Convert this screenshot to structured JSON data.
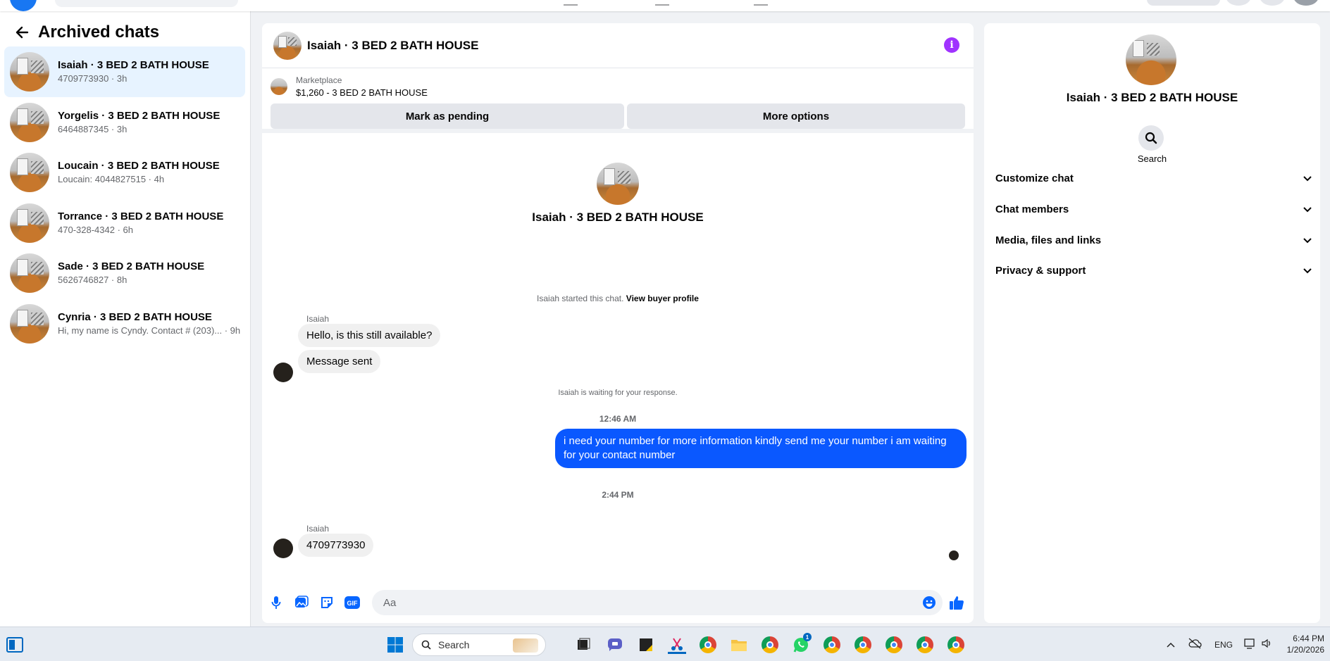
{
  "colors": {
    "accent": "#0a58ff",
    "info": "#a033ff",
    "active_row": "#e7f3ff",
    "panel_bg": "#f0f2f5"
  },
  "left_panel": {
    "title": "Archived chats",
    "chats": [
      {
        "name": "Isaiah · 3 BED 2 BATH HOUSE",
        "preview": "4709773930 · 3h",
        "active": true
      },
      {
        "name": "Yorgelis · 3 BED 2 BATH HOUSE",
        "preview": "6464887345 · 3h",
        "active": false
      },
      {
        "name": "Loucain · 3 BED 2 BATH HOUSE",
        "preview": "Loucain: 4044827515 · 4h",
        "active": false
      },
      {
        "name": "Torrance · 3 BED 2 BATH HOUSE",
        "preview": "470-328-4342 · 6h",
        "active": false
      },
      {
        "name": "Sade · 3 BED 2 BATH HOUSE",
        "preview": "5626746827 · 8h",
        "active": false
      },
      {
        "name": "Cynria · 3 BED 2 BATH HOUSE",
        "preview": "Hi, my name is Cyndy. Contact # (203)... · 9h",
        "active": false
      }
    ]
  },
  "conversation": {
    "title": "Isaiah · 3 BED 2 BATH HOUSE",
    "info_icon": "info-icon",
    "listing": {
      "label": "Marketplace",
      "price_title": "$1,260 - 3 BED 2 BATH HOUSE",
      "pending_button": "Mark as pending",
      "more_button": "More options"
    },
    "intro_name": "Isaiah · 3 BED 2 BATH HOUSE",
    "started_text": "Isaiah started this chat.",
    "buyer_profile_link": "View buyer profile",
    "sender_name": "Isaiah",
    "msg_1": "Hello, is this still available?",
    "msg_2": "Message sent",
    "waiting_text": "Isaiah is waiting for your response.",
    "time_1": "12:46 AM",
    "outgoing_msg": "i need your number for more information kindly send me your number i am waiting for your contact number",
    "time_2": "2:44 PM",
    "sender_name_2": "Isaiah",
    "msg_3": "4709773930",
    "input_placeholder": "Aa"
  },
  "right_panel": {
    "name": "Isaiah · 3 BED 2 BATH HOUSE",
    "search_label": "Search",
    "sections": [
      "Customize chat",
      "Chat members",
      "Media, files and links",
      "Privacy & support"
    ]
  },
  "taskbar": {
    "search_label": "Search",
    "whatsapp_badge": "1",
    "language": "ENG",
    "time": "6:44 PM",
    "date": "1/20/2026"
  }
}
